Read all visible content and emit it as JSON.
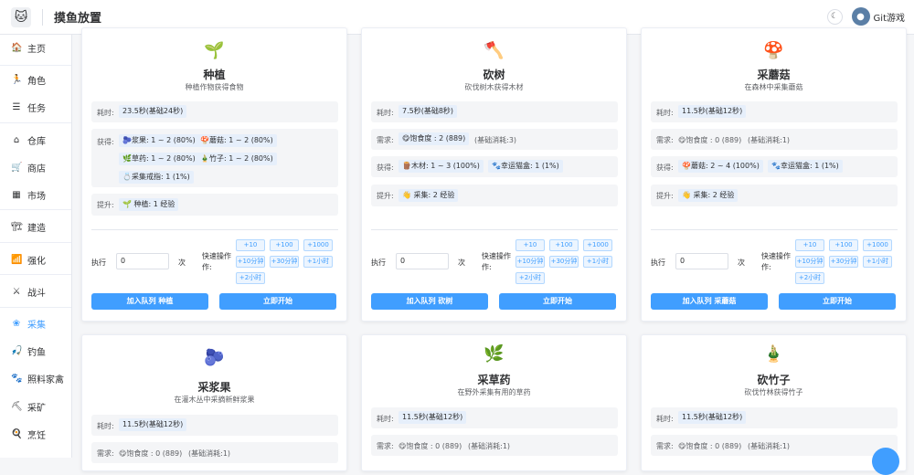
{
  "header": {
    "logo_icon": "cat-logo-icon",
    "logo_glyph": "🐱",
    "title": "摸鱼放置",
    "theme_glyph": "☾",
    "avatar_glyph": "●",
    "user": "Git游戏"
  },
  "sidebar": {
    "items": [
      {
        "icon": "🏠",
        "label": "主页",
        "active": false
      },
      {
        "icon": "🏃",
        "label": "角色",
        "active": false
      },
      {
        "icon": "☰",
        "label": "任务",
        "active": false
      },
      {
        "icon": "⌂",
        "label": "仓库",
        "active": false
      },
      {
        "icon": "🛒",
        "label": "商店",
        "active": false
      },
      {
        "icon": "▦",
        "label": "市场",
        "active": false
      },
      {
        "icon": "🏗",
        "label": "建造",
        "active": false
      },
      {
        "icon": "📶",
        "label": "强化",
        "active": false
      },
      {
        "icon": "⚔",
        "label": "战斗",
        "active": false
      },
      {
        "icon": "❀",
        "label": "采集",
        "active": true
      },
      {
        "icon": "🎣",
        "label": "钓鱼",
        "active": false
      },
      {
        "icon": "🐾",
        "label": "照料家禽",
        "active": false
      },
      {
        "icon": "⛏",
        "label": "采矿",
        "active": false
      },
      {
        "icon": "🍳",
        "label": "烹饪",
        "active": false
      }
    ]
  },
  "common": {
    "time_label": "耗时:",
    "need_label": "需求:",
    "gain_label": "获得:",
    "boost_label": "提升:",
    "exec_label": "执行",
    "times_unit": "次",
    "quick_label_1": "快速操作",
    "quick_label_2": "作:",
    "exec_value": "0",
    "quick": [
      "+10",
      "+100",
      "+1000",
      "+10分钟",
      "+30分钟",
      "+1小时",
      "+2小时"
    ],
    "start_label": "立即开始"
  },
  "cards": [
    {
      "icon": "🌱",
      "title": "种植",
      "desc": "种植作物获得食物",
      "time": "23.5秒(基础24秒)",
      "gains": [
        "🫐浆果: 1 ~ 2 (80%)",
        "🍄蘑菇: 1 ~ 2 (80%)",
        "🌿草药: 1 ~ 2 (80%)",
        "🎍竹子: 1 ~ 2 (80%)",
        "💍采集戒指: 1 (1%)"
      ],
      "boost": "🌱 种植: 1 经验",
      "queue": "加入队列 种植"
    },
    {
      "icon": "🪓",
      "title": "砍树",
      "desc": "砍伐树木获得木材",
      "time": "7.5秒(基础8秒)",
      "need": "😋饱食度 : 2 (889)",
      "need_extra": "(基础消耗:3)",
      "gains": [
        "🪵木材: 1 ~ 3 (100%)",
        "🐾幸运猫盒: 1 (1%)"
      ],
      "boost": "👋 采集: 2 经验",
      "queue": "加入队列 砍树"
    },
    {
      "icon": "🍄",
      "title": "采蘑菇",
      "desc": "在森林中采集蘑菇",
      "time": "11.5秒(基础12秒)",
      "need": "😋饱食度 : 0 (889)",
      "need_extra": "(基础消耗:1)",
      "gains": [
        "🍄蘑菇: 2 ~ 4 (100%)",
        "🐾幸运猫盒: 1 (1%)"
      ],
      "boost": "👋 采集: 2 经验",
      "queue": "加入队列 采蘑菇"
    },
    {
      "icon": "🫐",
      "title": "采浆果",
      "desc": "在灌木丛中采摘新鲜浆果",
      "time": "11.5秒(基础12秒)",
      "need": "😋饱食度 : 0 (889)",
      "need_extra": "(基础消耗:1)"
    },
    {
      "icon": "🌿",
      "title": "采草药",
      "desc": "在野外采集有用的草药",
      "time": "11.5秒(基础12秒)",
      "need": "😋饱食度 : 0 (889)",
      "need_extra": "(基础消耗:1)"
    },
    {
      "icon": "🎍",
      "title": "砍竹子",
      "desc": "砍伐竹林获得竹子",
      "time": "11.5秒(基础12秒)",
      "need": "😋饱食度 : 0 (889)",
      "need_extra": "(基础消耗:1)"
    }
  ]
}
